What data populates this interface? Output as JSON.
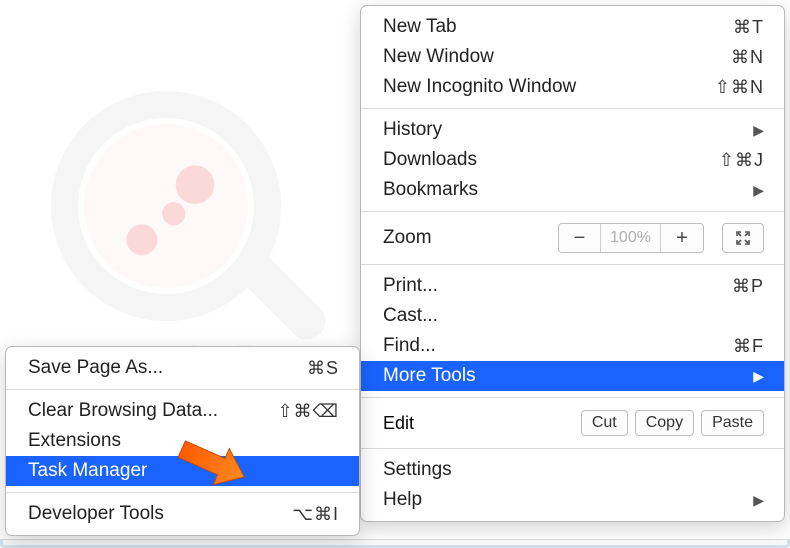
{
  "main_menu": {
    "new_tab": {
      "label": "New Tab",
      "shortcut": "⌘T"
    },
    "new_window": {
      "label": "New Window",
      "shortcut": "⌘N"
    },
    "new_incognito": {
      "label": "New Incognito Window",
      "shortcut": "⇧⌘N"
    },
    "history": {
      "label": "History"
    },
    "downloads": {
      "label": "Downloads",
      "shortcut": "⇧⌘J"
    },
    "bookmarks": {
      "label": "Bookmarks"
    },
    "zoom": {
      "label": "Zoom",
      "value": "100%"
    },
    "print": {
      "label": "Print...",
      "shortcut": "⌘P"
    },
    "cast": {
      "label": "Cast..."
    },
    "find": {
      "label": "Find...",
      "shortcut": "⌘F"
    },
    "more_tools": {
      "label": "More Tools"
    },
    "edit": {
      "label": "Edit",
      "cut": "Cut",
      "copy": "Copy",
      "paste": "Paste"
    },
    "settings": {
      "label": "Settings"
    },
    "help": {
      "label": "Help"
    }
  },
  "submenu": {
    "save_page": {
      "label": "Save Page As...",
      "shortcut": "⌘S"
    },
    "clear_data": {
      "label": "Clear Browsing Data...",
      "shortcut": "⇧⌘⌫"
    },
    "extensions": {
      "label": "Extensions"
    },
    "task_manager": {
      "label": "Task Manager"
    },
    "dev_tools": {
      "label": "Developer Tools",
      "shortcut": "⌥⌘I"
    }
  }
}
